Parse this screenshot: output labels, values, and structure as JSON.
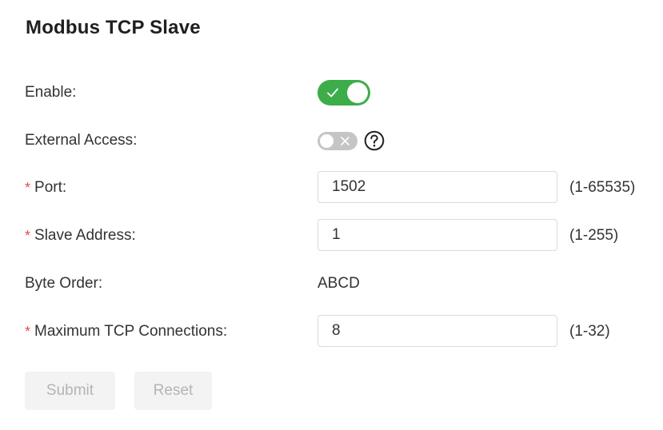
{
  "page": {
    "title": "Modbus TCP Slave"
  },
  "colors": {
    "accent_green": "#3cad49",
    "switch_off_gray": "#c5c5c5",
    "required_red": "#e34d59",
    "button_disabled_bg": "#f3f3f3",
    "button_disabled_text": "#b4b4b4"
  },
  "form": {
    "enable": {
      "label": "Enable:",
      "state": "on",
      "icon": "check-icon"
    },
    "external_access": {
      "label": "External Access:",
      "state": "off",
      "icon": "close-icon",
      "help_icon": "question-circle-icon"
    },
    "port": {
      "required_mark": "*",
      "label": "Port:",
      "value": "1502",
      "hint": "(1-65535)"
    },
    "slave_address": {
      "required_mark": "*",
      "label": "Slave Address:",
      "value": "1",
      "hint": "(1-255)"
    },
    "byte_order": {
      "label": "Byte Order:",
      "value": "ABCD"
    },
    "max_tcp_connections": {
      "required_mark": "*",
      "label": "Maximum TCP Connections:",
      "value": "8",
      "hint": "(1-32)"
    }
  },
  "actions": {
    "submit_label": "Submit",
    "reset_label": "Reset"
  }
}
